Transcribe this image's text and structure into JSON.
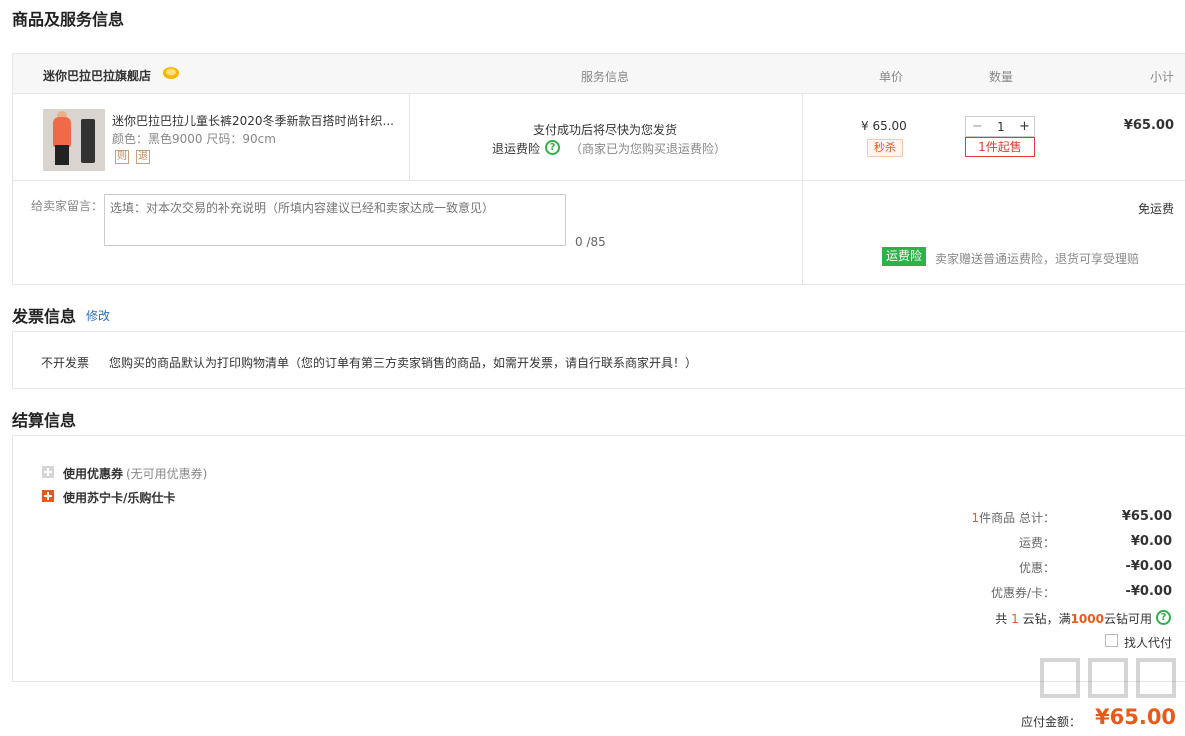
{
  "sections": {
    "goods_title": "商品及服务信息",
    "invoice_title": "发票信息",
    "invoice_edit": "修改",
    "settle_title": "结算信息"
  },
  "table_header": {
    "store_name": "迷你巴拉巴拉旗舰店",
    "service": "服务信息",
    "unit_price": "单价",
    "quantity": "数量",
    "subtotal": "小计"
  },
  "product": {
    "name": "迷你巴拉巴拉儿童长裤2020冬季新款百搭时尚针织...",
    "attrs": "颜色：黑色9000   尺码：90cm",
    "tag1": "则",
    "tag2": "退",
    "service_line1": "支付成功后将尽快为您发货",
    "service_ins": "退运费险",
    "service_ins_note": "（商家已为您购买退运费险）",
    "price": "¥ 65.00",
    "flash_tag": "秒杀",
    "qty": "1",
    "qty_minus": "−",
    "qty_plus": "+",
    "min_buy": "1件起售",
    "subtotal": "¥65.00"
  },
  "message": {
    "label": "给卖家留言：",
    "placeholder": "选填：对本次交易的补充说明（所填内容建议已经和卖家达成一致意见）",
    "count": "0 /85"
  },
  "shipping": {
    "free": "免运费",
    "ins_badge": "运费险",
    "ins_note": "卖家赠送普通运费险，退货可享受理赔"
  },
  "invoice": {
    "type": "不开发票",
    "desc": "您购买的商品默认为打印购物清单（您的订单有第三方卖家销售的商品，如需开发票，请自行联系商家开具！）"
  },
  "settle": {
    "coupon_label": "使用优惠券",
    "coupon_note": "(无可用优惠券)",
    "card_label": "使用苏宁卡/乐购仕卡",
    "rows": [
      {
        "label_count": "1",
        "label": "件商品 总计：",
        "value": "¥65.00"
      },
      {
        "label": "运费：",
        "value": "¥0.00"
      },
      {
        "label": "优惠：",
        "value": "-¥0.00"
      },
      {
        "label": "优惠券/卡：",
        "value": "-¥0.00"
      }
    ],
    "yz_prefix": "共",
    "yz_count": "1",
    "yz_mid": "云钻，满",
    "yz_min": "1000",
    "yz_suffix": "云钻可用",
    "proxy_pay": "找人代付",
    "due_label": "应付金额：",
    "due_value": "¥65.00"
  },
  "colors": {
    "accent": "#e8591a",
    "green": "#2fb14a",
    "link": "#2b6ec6",
    "red": "#e4393c"
  }
}
